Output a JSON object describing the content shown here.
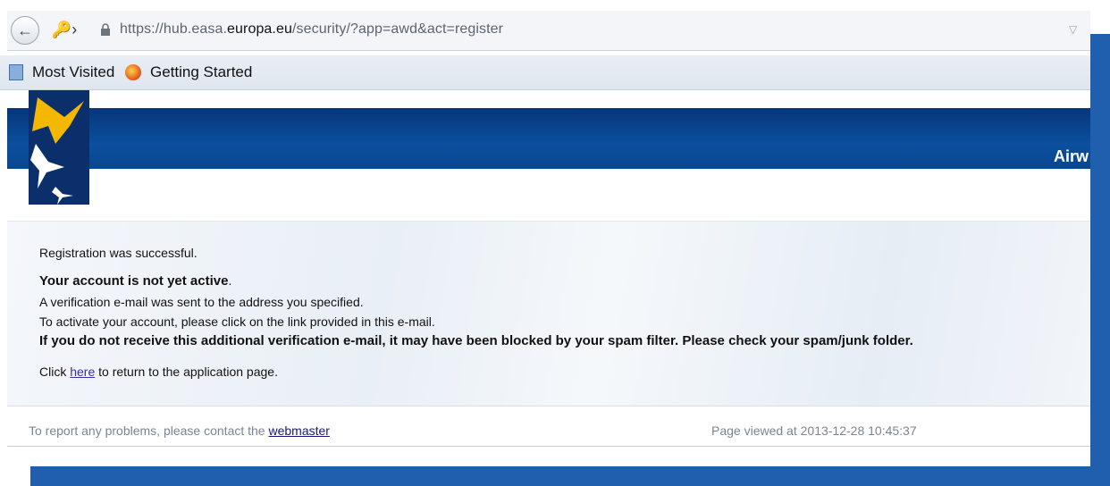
{
  "browser": {
    "url_prefix": "https://hub.easa.",
    "url_domain": "europa.eu",
    "url_suffix": "/security/?app=awd&act=register",
    "bookmarks": [
      {
        "label": "Most Visited"
      },
      {
        "label": "Getting Started"
      }
    ]
  },
  "banner": {
    "title": "Airw"
  },
  "message": {
    "line1": "Registration was successful.",
    "line2": "Your account is not yet active",
    "line2_suffix": ".",
    "line3": "A verification e-mail was sent to the address you specified.",
    "line4": "To activate your account, please click on the link provided in this e-mail.",
    "line5": "If you do not receive this additional verification e-mail, it may have been blocked by your spam filter. Please check your spam/junk folder.",
    "return_prefix": "Click ",
    "return_link": "here",
    "return_suffix": " to return to the application page."
  },
  "footer": {
    "report_prefix": "To report any problems, please contact the ",
    "report_link": "webmaster",
    "viewed": "Page viewed at 2013-12-28 10:45:37"
  },
  "colors": {
    "banner": "#0b4f9e",
    "frame": "#1f5fae",
    "link": "#3a2fa0"
  }
}
